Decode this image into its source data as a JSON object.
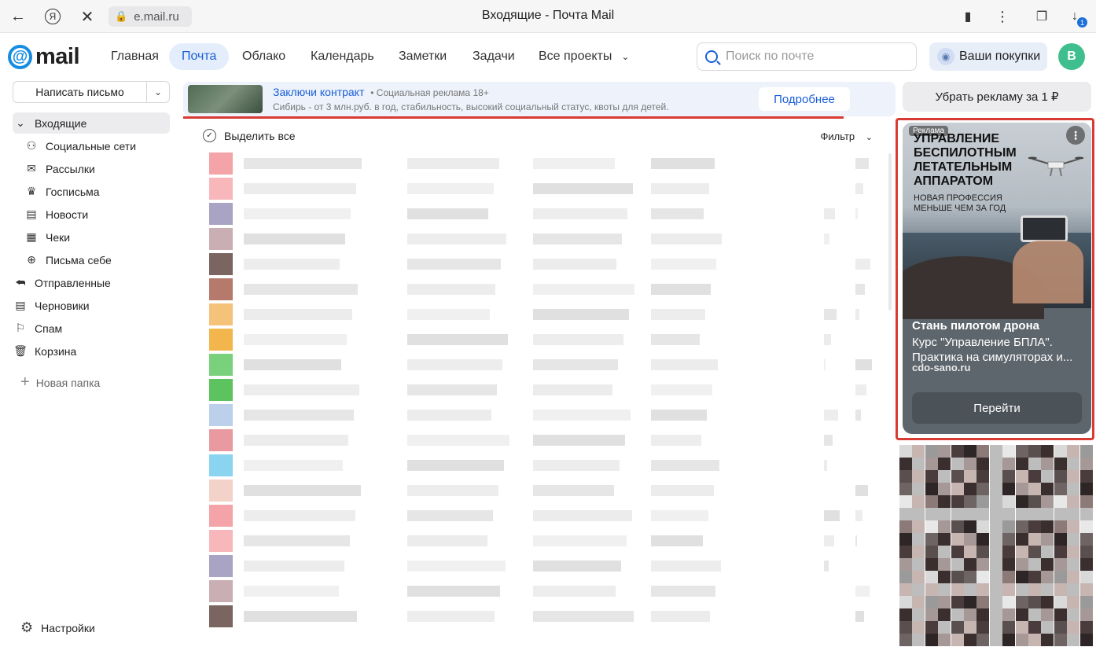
{
  "browser": {
    "url": "e.mail.ru",
    "window_title": "Входящие - Почта Mail",
    "download_badge": "1"
  },
  "header": {
    "logo_text": "mail",
    "nav": [
      "Главная",
      "Почта",
      "Облако",
      "Календарь",
      "Заметки",
      "Задачи",
      "Все проекты"
    ],
    "active_nav": "Почта",
    "search_placeholder": "Поиск по почте",
    "purchases_label": "Ваши покупки",
    "avatar_letter": "В"
  },
  "sidebar": {
    "compose_label": "Написать письмо",
    "folders": [
      {
        "label": "Входящие",
        "icon": "chevron-down-icon",
        "active": true,
        "sub": false
      },
      {
        "label": "Социальные сети",
        "icon": "people-icon",
        "sub": true
      },
      {
        "label": "Рассылки",
        "icon": "newsletter-icon",
        "sub": true
      },
      {
        "label": "Госписьма",
        "icon": "emblem-icon",
        "sub": true
      },
      {
        "label": "Новости",
        "icon": "news-icon",
        "sub": true
      },
      {
        "label": "Чеки",
        "icon": "receipt-icon",
        "sub": true
      },
      {
        "label": "Письма себе",
        "icon": "self-mail-icon",
        "sub": true
      },
      {
        "label": "Отправленные",
        "icon": "sent-icon",
        "sub": false
      },
      {
        "label": "Черновики",
        "icon": "drafts-icon",
        "sub": false
      },
      {
        "label": "Спам",
        "icon": "spam-icon",
        "sub": false
      },
      {
        "label": "Корзина",
        "icon": "trash-icon",
        "sub": false
      }
    ],
    "new_folder_label": "Новая папка",
    "settings_label": "Настройки"
  },
  "ad_bar": {
    "title": "Заключи контракт",
    "meta": "• Социальная реклама 18+",
    "description": "Сибирь - от 3 млн.руб. в год, стабильность, высокий социальный статус, квоты для детей.",
    "button": "Подробнее"
  },
  "toolbar": {
    "select_all": "Выделить все",
    "filter": "Фильтр"
  },
  "right_ads": {
    "remove_ad": "Убрать рекламу за 1 ₽",
    "card": {
      "label": "Реклама",
      "headline": "УПРАВЛЕНИЕ БЕСПИЛОТНЫМ ЛЕТАТЕЛЬНЫМ АППАРАТОМ",
      "subline": "НОВАЯ ПРОФЕССИЯ МЕНЬШЕ ЧЕМ ЗА ГОД",
      "title": "Стань пилотом дрона",
      "text": "Курс \"Управление БПЛА\". Практика на симуляторах и...",
      "domain": "cdo-sano.ru",
      "button": "Перейти"
    }
  },
  "colors": {
    "accent": "#1a5fd6",
    "highlight": "#d93a34",
    "logo_blue": "#168de2"
  }
}
